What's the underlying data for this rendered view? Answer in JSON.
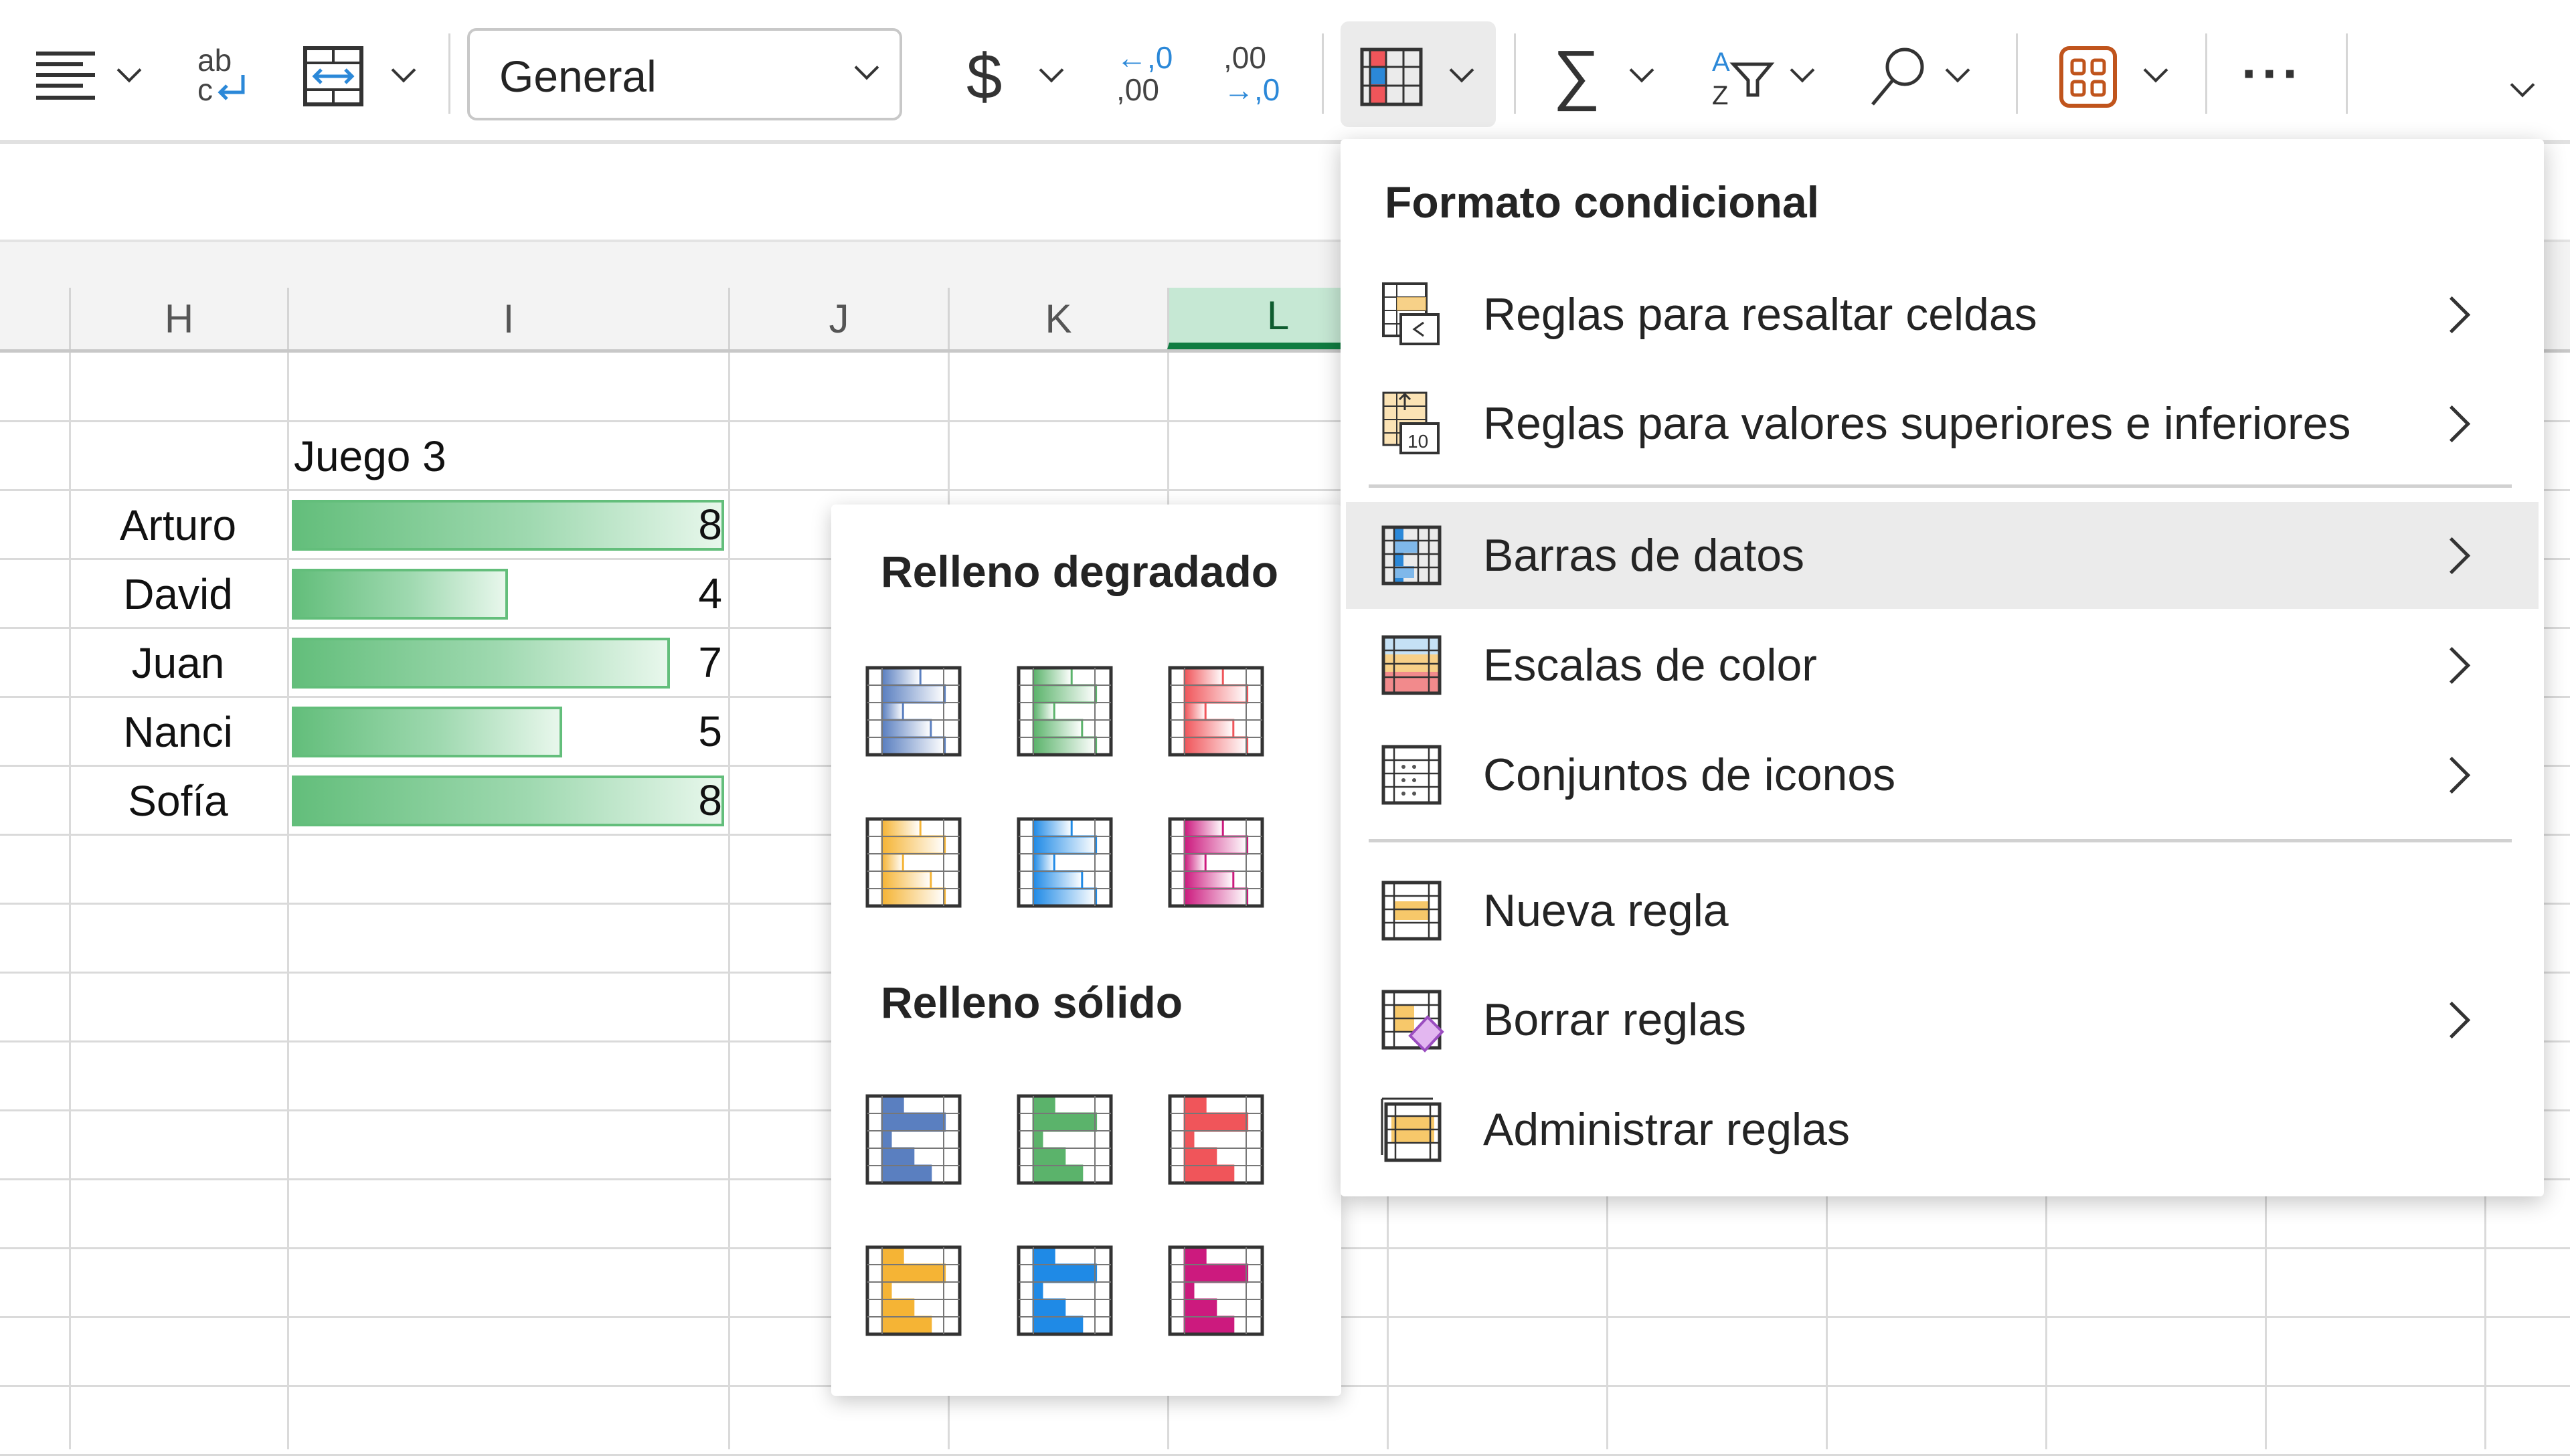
{
  "toolbar": {
    "number_format": "General",
    "buttons": [
      {
        "name": "align-button",
        "icon": "align-left-icon",
        "has_dropdown": true
      },
      {
        "name": "wrap-text-button",
        "icon": "wrap-text-icon",
        "has_dropdown": false
      },
      {
        "name": "merge-cells-button",
        "icon": "merge-cells-icon",
        "has_dropdown": true
      },
      {
        "name": "currency-button",
        "icon": "dollar-icon",
        "has_dropdown": true
      },
      {
        "name": "increase-decimal-button",
        "icon": "increase-decimal-icon",
        "has_dropdown": false
      },
      {
        "name": "decrease-decimal-button",
        "icon": "decrease-decimal-icon",
        "has_dropdown": false
      },
      {
        "name": "conditional-format-button",
        "icon": "conditional-format-icon",
        "has_dropdown": true,
        "active": true
      },
      {
        "name": "autosum-button",
        "icon": "sigma-icon",
        "has_dropdown": true
      },
      {
        "name": "sort-filter-button",
        "icon": "sort-filter-icon",
        "has_dropdown": true
      },
      {
        "name": "find-button",
        "icon": "search-icon",
        "has_dropdown": true
      },
      {
        "name": "add-ins-button",
        "icon": "grid-apps-icon",
        "has_dropdown": true
      },
      {
        "name": "more-options-button",
        "icon": "ellipsis-icon",
        "has_dropdown": false
      }
    ],
    "decimal_labels": {
      "inc_top": "←,0",
      "inc_bottom": ",00",
      "dec_top": ",00",
      "dec_bottom": "→,0"
    },
    "currency_symbol": "$",
    "sigma_symbol": "∑",
    "more_symbol": "···"
  },
  "sheet": {
    "columns": [
      "H",
      "I",
      "J",
      "K",
      "L"
    ],
    "selected_column": "L",
    "header_cell": "Juego 3",
    "rows": [
      {
        "name": "Arturo",
        "value": 8
      },
      {
        "name": "David",
        "value": 4
      },
      {
        "name": "Juan",
        "value": 7
      },
      {
        "name": "Nanci",
        "value": 5
      },
      {
        "name": "Sofía",
        "value": 8
      }
    ],
    "data_bar_color": "#63be7b"
  },
  "data_bars_submenu": {
    "gradient_title": "Relleno degradado",
    "solid_title": "Relleno sólido",
    "colors": [
      {
        "name": "blue",
        "hex": "#5a7fc0"
      },
      {
        "name": "green",
        "hex": "#5bb36b"
      },
      {
        "name": "red",
        "hex": "#f0555a"
      },
      {
        "name": "orange",
        "hex": "#f5b435"
      },
      {
        "name": "light-blue",
        "hex": "#1f8ae6"
      },
      {
        "name": "purple",
        "hex": "#cc1a7e"
      }
    ]
  },
  "conditional_format_menu": {
    "title": "Formato condicional",
    "items": [
      {
        "label": "Reglas para resaltar celdas",
        "icon": "highlight-cells-rules-icon",
        "submenu": true
      },
      {
        "label": "Reglas para valores superiores e inferiores",
        "icon": "top-bottom-rules-icon",
        "submenu": true
      },
      {
        "label": "Barras de datos",
        "icon": "data-bars-icon",
        "submenu": true,
        "highlighted": true
      },
      {
        "label": "Escalas de color",
        "icon": "color-scales-icon",
        "submenu": true
      },
      {
        "label": "Conjuntos de iconos",
        "icon": "icon-sets-icon",
        "submenu": true
      },
      {
        "label": "Nueva regla",
        "icon": "new-rule-icon",
        "submenu": false
      },
      {
        "label": "Borrar reglas",
        "icon": "clear-rules-icon",
        "submenu": true
      },
      {
        "label": "Administrar reglas",
        "icon": "manage-rules-icon",
        "submenu": false
      }
    ]
  }
}
